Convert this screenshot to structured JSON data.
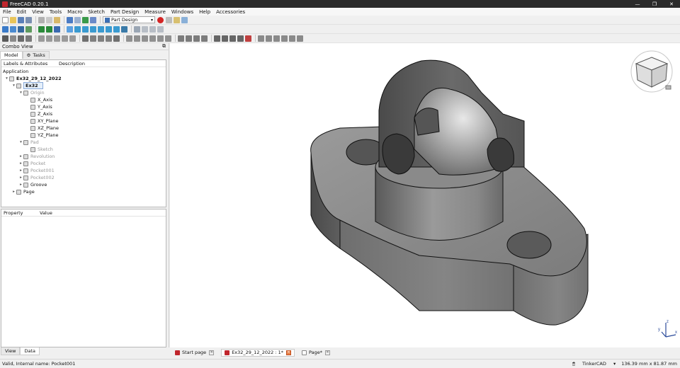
{
  "window": {
    "title": "FreeCAD 0.20.1",
    "controls": [
      "—",
      "❐",
      "✕"
    ]
  },
  "menu": [
    "File",
    "Edit",
    "View",
    "Tools",
    "Macro",
    "Sketch",
    "Part Design",
    "Measure",
    "Windows",
    "Help",
    "Accessories"
  ],
  "toolbar": {
    "workbench": "Part Design"
  },
  "combo_view": {
    "title": "Combo View",
    "tabs": [
      "Model",
      "Tasks"
    ],
    "tree_header": {
      "labels": "Labels & Attributes",
      "description": "Description"
    },
    "tree_root": "Application",
    "tree": [
      {
        "label": "Ex32_29_12_2022",
        "indent": 0,
        "exp": "▾",
        "bold": true,
        "dim": false,
        "sel": false
      },
      {
        "label": "Ex32",
        "indent": 1,
        "exp": "▾",
        "bold": true,
        "dim": false,
        "sel": true
      },
      {
        "label": "Origin",
        "indent": 2,
        "exp": "▾",
        "bold": false,
        "dim": true,
        "sel": false
      },
      {
        "label": "X_Axis",
        "indent": 3,
        "exp": "",
        "bold": false,
        "dim": false,
        "sel": false
      },
      {
        "label": "Y_Axis",
        "indent": 3,
        "exp": "",
        "bold": false,
        "dim": false,
        "sel": false
      },
      {
        "label": "Z_Axis",
        "indent": 3,
        "exp": "",
        "bold": false,
        "dim": false,
        "sel": false
      },
      {
        "label": "XY_Plane",
        "indent": 3,
        "exp": "",
        "bold": false,
        "dim": false,
        "sel": false
      },
      {
        "label": "XZ_Plane",
        "indent": 3,
        "exp": "",
        "bold": false,
        "dim": false,
        "sel": false
      },
      {
        "label": "YZ_Plane",
        "indent": 3,
        "exp": "",
        "bold": false,
        "dim": false,
        "sel": false
      },
      {
        "label": "Pad",
        "indent": 2,
        "exp": "▾",
        "bold": false,
        "dim": true,
        "sel": false
      },
      {
        "label": "Sketch",
        "indent": 3,
        "exp": "",
        "bold": false,
        "dim": true,
        "sel": false
      },
      {
        "label": "Revolution",
        "indent": 2,
        "exp": "▸",
        "bold": false,
        "dim": true,
        "sel": false
      },
      {
        "label": "Pocket",
        "indent": 2,
        "exp": "▸",
        "bold": false,
        "dim": true,
        "sel": false
      },
      {
        "label": "Pocket001",
        "indent": 2,
        "exp": "▸",
        "bold": false,
        "dim": true,
        "sel": false
      },
      {
        "label": "Pocket002",
        "indent": 2,
        "exp": "▸",
        "bold": false,
        "dim": true,
        "sel": false
      },
      {
        "label": "Groove",
        "indent": 2,
        "exp": "▸",
        "bold": false,
        "dim": false,
        "sel": false
      },
      {
        "label": "Page",
        "indent": 1,
        "exp": "▸",
        "bold": false,
        "dim": false,
        "sel": false
      }
    ],
    "property_header": {
      "property": "Property",
      "value": "Value"
    },
    "property_tabs": [
      "View",
      "Data"
    ]
  },
  "document_tabs": [
    {
      "label": "Start page",
      "active": false,
      "modified": false
    },
    {
      "label": "Ex32_29_12_2022 : 1*",
      "active": true,
      "modified": true
    },
    {
      "label": "Page*",
      "active": false,
      "modified": false
    }
  ],
  "status": {
    "message": "Valid, Internal name: Pocket001",
    "navigation": "TinkerCAD",
    "dimensions": "136.39 mm x 81.87 mm"
  },
  "colors": {
    "accent": "#c0262d",
    "selection": "#e5effa",
    "model": "#8c8c8c"
  }
}
